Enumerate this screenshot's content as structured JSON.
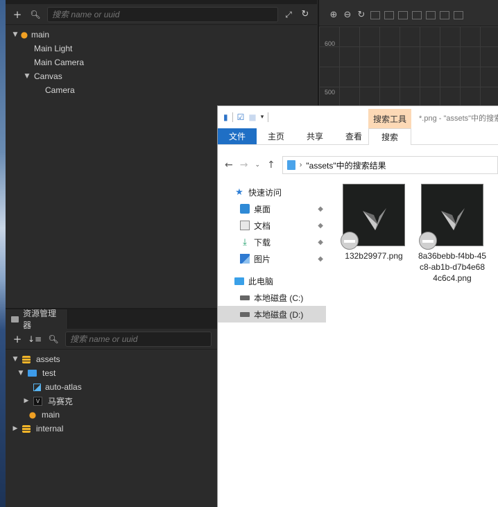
{
  "hierarchy": {
    "search_placeholder": "搜索 name or uuid",
    "nodes": [
      {
        "label": "main"
      },
      {
        "label": "Main Light"
      },
      {
        "label": "Main Camera"
      },
      {
        "label": "Canvas"
      },
      {
        "label": "Camera"
      }
    ]
  },
  "scene": {
    "axis_labels": [
      "600",
      "500"
    ]
  },
  "assets": {
    "tab_label": "资源管理器",
    "search_placeholder": "搜索 name or uuid",
    "nodes": [
      {
        "label": "assets"
      },
      {
        "label": "test"
      },
      {
        "label": "auto-atlas"
      },
      {
        "label": "马赛克"
      },
      {
        "label": "main"
      },
      {
        "label": "internal"
      }
    ]
  },
  "explorer": {
    "title": "*.png - \"assets\"中的搜索结果",
    "contextual_tab": "搜索工具",
    "ribbon_tabs": [
      "文件",
      "主页",
      "共享",
      "查看",
      "搜索"
    ],
    "address": "\"assets\"中的搜索结果",
    "nav": [
      {
        "label": "快速访问"
      },
      {
        "label": "桌面"
      },
      {
        "label": "文档"
      },
      {
        "label": "下载"
      },
      {
        "label": "图片"
      },
      {
        "label": "此电脑"
      },
      {
        "label": "本地磁盘 (C:)"
      },
      {
        "label": "本地磁盘 (D:)"
      }
    ],
    "files": [
      {
        "name": "132b29977.png"
      },
      {
        "name": "8a36bebb-f4bb-45c8-ab1b-d7b4e684c6c4.png"
      }
    ]
  },
  "colors": {
    "editor_bg": "#2b2b2b",
    "explorer_accent": "#1f6fc5",
    "search_tools_tab": "#fcd9b6"
  }
}
